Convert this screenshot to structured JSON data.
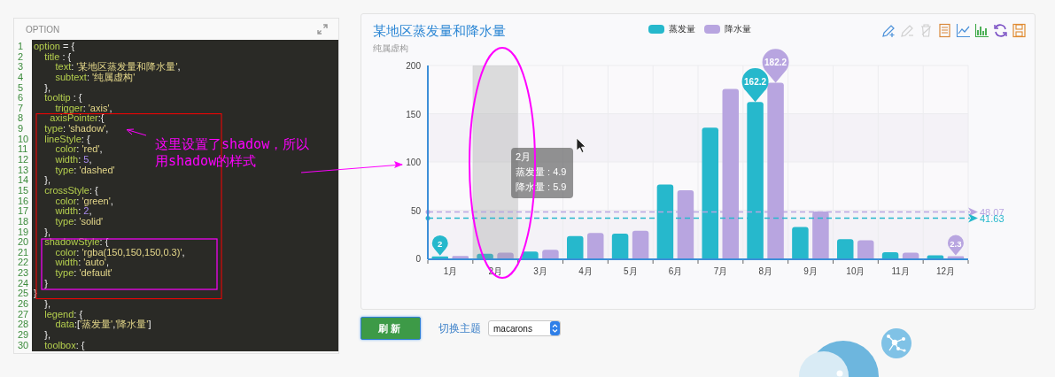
{
  "editor": {
    "title": "OPTION",
    "lines": [
      {
        "number": "1",
        "code": "option = {"
      },
      {
        "number": "2",
        "code": "    title : {"
      },
      {
        "number": "3",
        "code": "        text: '某地区蒸发量和降水量',"
      },
      {
        "number": "4",
        "code": "        subtext: '纯属虚构'"
      },
      {
        "number": "5",
        "code": "    },"
      },
      {
        "number": "6",
        "code": "    tooltip : {"
      },
      {
        "number": "7",
        "code": "        trigger: 'axis',"
      },
      {
        "number": "8",
        "code": "      axisPointer:{"
      },
      {
        "number": "9",
        "code": "    type: 'shadow',"
      },
      {
        "number": "10",
        "code": "    lineStyle: {"
      },
      {
        "number": "11",
        "code": "        color: 'red',"
      },
      {
        "number": "12",
        "code": "        width: 5,"
      },
      {
        "number": "13",
        "code": "        type: 'dashed'"
      },
      {
        "number": "14",
        "code": "    },"
      },
      {
        "number": "15",
        "code": "    crossStyle: {"
      },
      {
        "number": "16",
        "code": "        color: 'green',"
      },
      {
        "number": "17",
        "code": "        width: 2,"
      },
      {
        "number": "18",
        "code": "        type: 'solid'"
      },
      {
        "number": "19",
        "code": "    },"
      },
      {
        "number": "20",
        "code": "    shadowStyle: {"
      },
      {
        "number": "21",
        "code": "        color: 'rgba(150,150,150,0.3)',"
      },
      {
        "number": "22",
        "code": "        width: 'auto',"
      },
      {
        "number": "23",
        "code": "        type: 'default'"
      },
      {
        "number": "24",
        "code": "    }"
      },
      {
        "number": "25",
        "code": "}"
      },
      {
        "number": "26",
        "code": "    },"
      },
      {
        "number": "27",
        "code": "    legend: {"
      },
      {
        "number": "28",
        "code": "        data:['蒸发量','降水量']"
      },
      {
        "number": "29",
        "code": "    },"
      },
      {
        "number": "30",
        "code": "    toolbox: {"
      }
    ]
  },
  "annotation": {
    "note_lines": [
      "这里设置了shadow，所以",
      "用shadow的样式"
    ]
  },
  "chart": {
    "title": "某地区蒸发量和降水量",
    "subtitle": "纯属虚构",
    "toolbox": [
      {
        "kind": "mark",
        "disabled": false
      },
      {
        "kind": "mark-undo",
        "disabled": true
      },
      {
        "kind": "mark-clear",
        "disabled": true
      },
      {
        "kind": "data-view",
        "disabled": false
      },
      {
        "kind": "line",
        "disabled": false
      },
      {
        "kind": "bar",
        "disabled": false
      },
      {
        "kind": "restore",
        "disabled": false
      },
      {
        "kind": "save",
        "disabled": false
      }
    ],
    "tooltip": {
      "title": "2月",
      "lines": [
        "蒸发量 : 4.9",
        "降水量 : 5.9"
      ]
    },
    "chart_data": {
      "type": "bar",
      "categories": [
        "1月",
        "2月",
        "3月",
        "4月",
        "5月",
        "6月",
        "7月",
        "8月",
        "9月",
        "10月",
        "11月",
        "12月"
      ],
      "series": [
        {
          "name": "蒸发量",
          "color": "#26b8cc",
          "values": [
            2.0,
            4.9,
            7.0,
            23.2,
            25.6,
            76.7,
            135.6,
            162.2,
            32.6,
            20.0,
            6.4,
            3.3
          ]
        },
        {
          "name": "降水量",
          "color": "#b8a5e0",
          "values": [
            2.6,
            5.9,
            9.0,
            26.4,
            28.7,
            70.7,
            175.6,
            182.2,
            48.7,
            18.8,
            6.0,
            2.3
          ]
        }
      ],
      "ylim": [
        0,
        200
      ],
      "yticks": [
        0,
        50,
        100,
        150,
        200
      ],
      "grid": true,
      "ref_lines": [
        {
          "axis": "y",
          "value": 48.07,
          "label": "48.07",
          "color": "#b8a5e0"
        },
        {
          "axis": "y",
          "value": 41.63,
          "label": "41.63",
          "color": "#26b8cc"
        }
      ],
      "bands": [
        {
          "axis": "x",
          "from": "2月",
          "to": "2月"
        }
      ],
      "annotations": [
        {
          "text": "162.2",
          "x": "8月",
          "y": 162.2
        },
        {
          "text": "182.2",
          "x": "8月",
          "y": 182.2
        },
        {
          "text": "2",
          "x": "1月",
          "y": 2.0
        },
        {
          "text": "2.3",
          "x": "12月",
          "y": 2.3
        }
      ]
    }
  },
  "controls": {
    "refresh_button": "刷新",
    "theme_label": "切换主题",
    "theme_select": "macarons"
  }
}
